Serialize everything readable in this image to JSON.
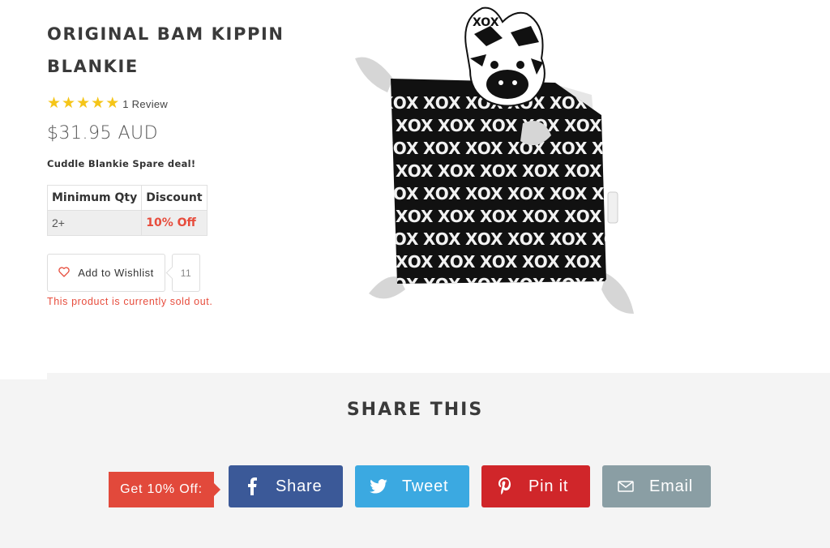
{
  "product": {
    "title_line1": "ORIGINAL BAM KIPPIN",
    "title_line2": "BLANKIE",
    "stars": 5,
    "review_text": "1 Review",
    "price": "$31.95 AUD",
    "deal_text": "Cuddle Blankie Spare deal!",
    "discount_table": {
      "headers": [
        "Minimum Qty",
        "Discount"
      ],
      "rows": [
        [
          "2+",
          "10% Off"
        ]
      ]
    },
    "wishlist_label": "Add to Wishlist",
    "wishlist_count": "11",
    "sold_out_text": "This product is currently sold out.",
    "image_print_text": "XOX"
  },
  "share": {
    "title": "SHARE THIS",
    "promo_label": "Get 10% Off:",
    "buttons": {
      "facebook": "Share",
      "twitter": "Tweet",
      "pinterest": "Pin it",
      "email": "Email"
    }
  },
  "colors": {
    "sale_red": "#e74c3c",
    "star_yellow": "#f5c518",
    "facebook": "#3b5998",
    "twitter": "#3ba9e1",
    "pinterest": "#d0262a",
    "email": "#8a9ea4",
    "share_bg": "#f4f4f4"
  }
}
